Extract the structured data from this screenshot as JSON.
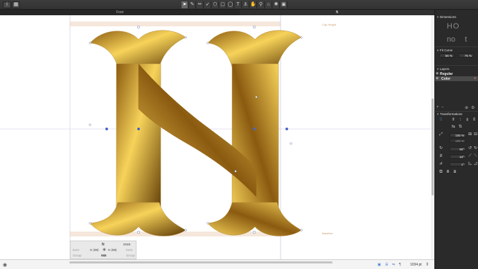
{
  "toolbar": {
    "info_icon": "info-icon",
    "grid_icon": "grid-icon",
    "tools": [
      "select-tool",
      "pen-tool",
      "draw-tool",
      "brush-tool",
      "primitives-tool",
      "rectangle-tool",
      "oval-tool",
      "text-tool",
      "anchor-tool",
      "hand-tool",
      "zoom-tool",
      "annotation-tool",
      "sun-tool",
      "extra-tool"
    ],
    "tool_glyphs": [
      "➤",
      "✎",
      "✏",
      "➶",
      "⬡",
      "▢",
      "◯",
      "T",
      "⚓",
      "✋",
      "⚲",
      "⌂",
      "✺",
      "▣"
    ]
  },
  "tabs": [
    {
      "label": "Font",
      "active": false
    },
    {
      "label": "N",
      "active": true
    }
  ],
  "canvas": {
    "cap_height_label": "Cap Height",
    "baseline_label": "Baseline",
    "glyph_color_start": "#8a5a10",
    "glyph_color_mid": "#f7d35a",
    "glyph_color_end": "#5e3a06"
  },
  "info_box": {
    "glyph_name": "N",
    "unicode": "004E",
    "kern_left_label": "Kern",
    "kern_right_label": "Kern",
    "left_metric": "H (98)",
    "right_metric": "H (98)",
    "group_left_label": "Group",
    "group_right_label": "Group",
    "width": "988"
  },
  "panel": {
    "dimensions_title": "Dimensions",
    "dim_preview_top": "HO",
    "dim_preview_bottom_left": "no",
    "dim_preview_bottom_right": "t",
    "fit_curve_title": "Fit Curve",
    "fit_curve_left": "56 %",
    "fit_curve_right": "75 %",
    "layers_title": "Layers",
    "layers": [
      {
        "name": "Regular",
        "selected": false
      },
      {
        "name": "Color",
        "selected": true
      }
    ],
    "transformations_title": "Transformations",
    "scale_x": "105 %",
    "scale_y": "105 %",
    "rotate": "90°",
    "slant": "10°",
    "skew": "1°"
  },
  "bottom": {
    "eye_icon": "eye-icon",
    "zoom_value": "1034 pt"
  }
}
